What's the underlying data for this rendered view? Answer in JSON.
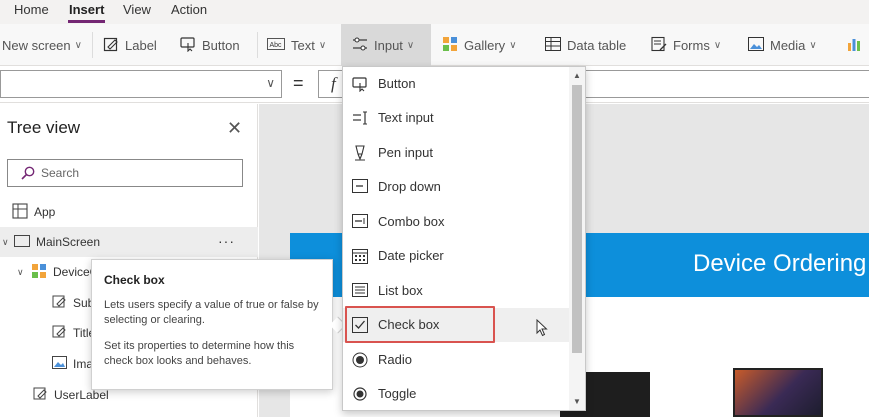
{
  "menubar": {
    "items": [
      "Home",
      "Insert",
      "View",
      "Action"
    ],
    "active": "Insert"
  },
  "ribbon": {
    "new_screen": "New screen",
    "label": "Label",
    "button": "Button",
    "text": "Text",
    "input": "Input",
    "gallery": "Gallery",
    "data_table": "Data table",
    "forms": "Forms",
    "media": "Media"
  },
  "formula": {
    "equals": "=",
    "fx": "f"
  },
  "tree": {
    "title": "Tree view",
    "search_placeholder": "Search",
    "rows": [
      {
        "label": "App",
        "icon": "app-icon"
      },
      {
        "label": "MainScreen",
        "icon": "screen-icon"
      },
      {
        "label": "DeviceG",
        "icon": "gallery-icon"
      },
      {
        "label": "Sub",
        "icon": "edit-icon"
      },
      {
        "label": "Title",
        "icon": "edit-icon"
      },
      {
        "label": "Ima",
        "icon": "image-icon"
      },
      {
        "label": "UserLabel",
        "icon": "edit-icon"
      }
    ],
    "more": "···"
  },
  "tooltip": {
    "title": "Check box",
    "p1": "Lets users specify a value of true or false by selecting or clearing.",
    "p2": "Set its properties to determine how this check box looks and behaves."
  },
  "canvas": {
    "banner_text": "Device Ordering"
  },
  "dropdown": {
    "items": [
      {
        "label": "Button",
        "icon": "button-icon"
      },
      {
        "label": "Text input",
        "icon": "text-input-icon"
      },
      {
        "label": "Pen input",
        "icon": "pen-icon"
      },
      {
        "label": "Drop down",
        "icon": "dropdown-icon"
      },
      {
        "label": "Combo box",
        "icon": "combo-box-icon"
      },
      {
        "label": "Date picker",
        "icon": "calendar-icon"
      },
      {
        "label": "List box",
        "icon": "list-box-icon"
      },
      {
        "label": "Check box",
        "icon": "checkbox-icon"
      },
      {
        "label": "Radio",
        "icon": "radio-icon"
      },
      {
        "label": "Toggle",
        "icon": "toggle-icon"
      }
    ],
    "highlighted": "Check box"
  },
  "colors": {
    "accent": "#742774",
    "banner": "#0d8fdb",
    "highlight_border": "#d9534f"
  }
}
